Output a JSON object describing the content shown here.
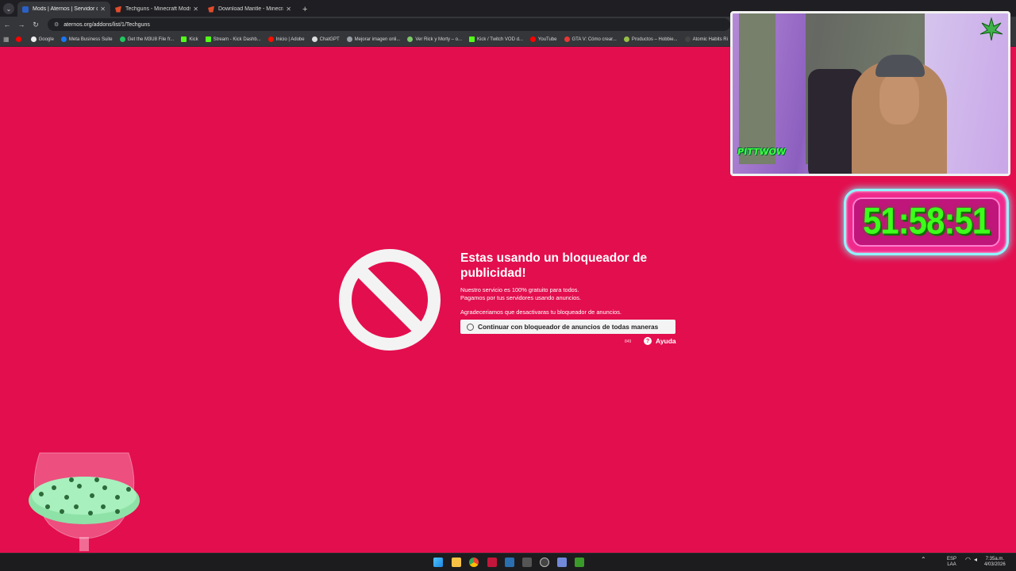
{
  "browser": {
    "tabs": [
      {
        "title": "Mods | Aternos | Servidor de M",
        "active": true,
        "favicon_color": "#2b61c7"
      },
      {
        "title": "Techguns - Minecraft Mods - C",
        "active": false,
        "favicon_color": "#e04c2b"
      },
      {
        "title": "Download Mantle - Minecraft M",
        "active": false,
        "favicon_color": "#e04c2b"
      }
    ],
    "new_tab_label": "+",
    "url": "aternos.org/addons/list/1/Techguns",
    "bookmarks": [
      {
        "label": "",
        "color": "#ff0000"
      },
      {
        "label": "Google",
        "color": "#eeeeee"
      },
      {
        "label": "Meta Business Suite",
        "color": "#1877f2"
      },
      {
        "label": "Get the M3U8 File fr...",
        "color": "#22c55e"
      },
      {
        "label": "Kick",
        "color": "#53fc18"
      },
      {
        "label": "Stream - Kick Dashb...",
        "color": "#53fc18"
      },
      {
        "label": "Inicio | Adobe",
        "color": "#fa0f00"
      },
      {
        "label": "ChatGPT",
        "color": "#dddddd"
      },
      {
        "label": "Mejorar imagen onli...",
        "color": "#9aa0a6"
      },
      {
        "label": "Ver Rick y Morty – o...",
        "color": "#7cc96b"
      },
      {
        "label": "Kick / Twitch VOD d...",
        "color": "#53fc18"
      },
      {
        "label": "YouTube",
        "color": "#ff0000"
      },
      {
        "label": "GTA V: Cómo crear...",
        "color": "#e53935"
      },
      {
        "label": "Productos – Hobbie...",
        "color": "#96bf48"
      },
      {
        "label": "Atomic Habits Ri",
        "color": "#444444"
      }
    ]
  },
  "notice": {
    "title": "Estas usando un bloqueador de publicidad!",
    "line1": "Nuestro servicio es 100% gratuito para todos.",
    "line2": "Pagamos por tus servidores usando anuncios.",
    "line3": "Agradeceriamos que desactivaras tu bloqueador de anuncios.",
    "continue_label": "Continuar con bloqueador de anuncios de todas maneras",
    "code": "849",
    "help_label": "Ayuda"
  },
  "overlay": {
    "timer": "51:58:51",
    "cam_logo": "PITTWOW"
  },
  "taskbar": {
    "lang": "ESP",
    "lang_sub": "LAA",
    "time": "7:35a.m.",
    "date": "4/03/2026"
  },
  "colors": {
    "page_background": "#e30e4e",
    "timer_green": "#3cff1a"
  }
}
